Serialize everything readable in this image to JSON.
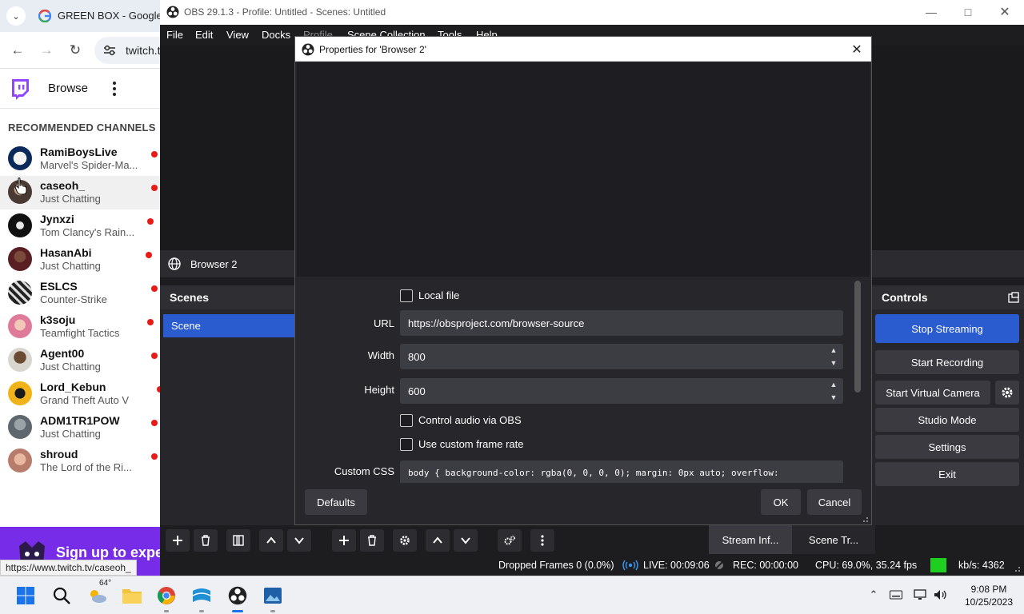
{
  "chrome": {
    "tab_title": "GREEN BOX - Google Se",
    "omnibox_text": "twitch.tv",
    "status_url": "https://www.twitch.tv/caseoh_"
  },
  "twitch": {
    "browse_label": "Browse",
    "recommended_heading": "RECOMMENDED CHANNELS",
    "channels": [
      {
        "name": "RamiBoysLive",
        "category": "Marvel's Spider-Ma..."
      },
      {
        "name": "caseoh_",
        "category": "Just Chatting"
      },
      {
        "name": "Jynxzi",
        "category": "Tom Clancy's Rain..."
      },
      {
        "name": "HasanAbi",
        "category": "Just Chatting"
      },
      {
        "name": "ESLCS",
        "category": "Counter-Strike"
      },
      {
        "name": "k3soju",
        "category": "Teamfight Tactics"
      },
      {
        "name": "Agent00",
        "category": "Just Chatting"
      },
      {
        "name": "Lord_Kebun",
        "category": "Grand Theft Auto V"
      },
      {
        "name": "ADM1TR1POW",
        "category": "Just Chatting"
      },
      {
        "name": "shroud",
        "category": "The Lord of the Ri..."
      }
    ],
    "signup_text": "Sign up to expe"
  },
  "obs": {
    "window_title": "OBS 29.1.3 - Profile: Untitled - Scenes: Untitled",
    "menu": [
      "File",
      "Edit",
      "View",
      "Docks",
      "Profile",
      "Scene Collection",
      "Tools",
      "Help"
    ],
    "source_name": "Browser 2",
    "scenes_title": "Scenes",
    "scene_item": "Scene",
    "controls_title": "Controls",
    "controls": {
      "stop_streaming": "Stop Streaming",
      "start_recording": "Start Recording",
      "start_virtual_camera": "Start Virtual Camera",
      "studio_mode": "Studio Mode",
      "settings": "Settings",
      "exit": "Exit"
    },
    "dock_tabs": {
      "stream_info": "Stream Inf...",
      "scene_transitions": "Scene Tr..."
    },
    "status": {
      "dropped_frames": "Dropped Frames 0 (0.0%)",
      "live": "LIVE: 00:09:06",
      "rec": "REC: 00:00:00",
      "cpu": "CPU: 69.0%, 35.24 fps",
      "kbs": "kb/s: 4362"
    },
    "accent_color": "#2a5bcf",
    "status_good_color": "#1fcf1f"
  },
  "dialog": {
    "title": "Properties for 'Browser 2'",
    "local_file_label": "Local file",
    "local_file_checked": false,
    "url_label": "URL",
    "url_value": "https://obsproject.com/browser-source",
    "width_label": "Width",
    "width_value": "800",
    "height_label": "Height",
    "height_value": "600",
    "control_audio_label": "Control audio via OBS",
    "control_audio_checked": false,
    "custom_frame_rate_label": "Use custom frame rate",
    "custom_frame_rate_checked": false,
    "custom_css_label": "Custom CSS",
    "custom_css_value": "body { background-color: rgba(0, 0, 0, 0); margin: 0px auto; overflow:",
    "defaults_label": "Defaults",
    "ok_label": "OK",
    "cancel_label": "Cancel"
  },
  "taskbar": {
    "weather_temp": "64°",
    "time": "9:08 PM",
    "date": "10/25/2023"
  }
}
